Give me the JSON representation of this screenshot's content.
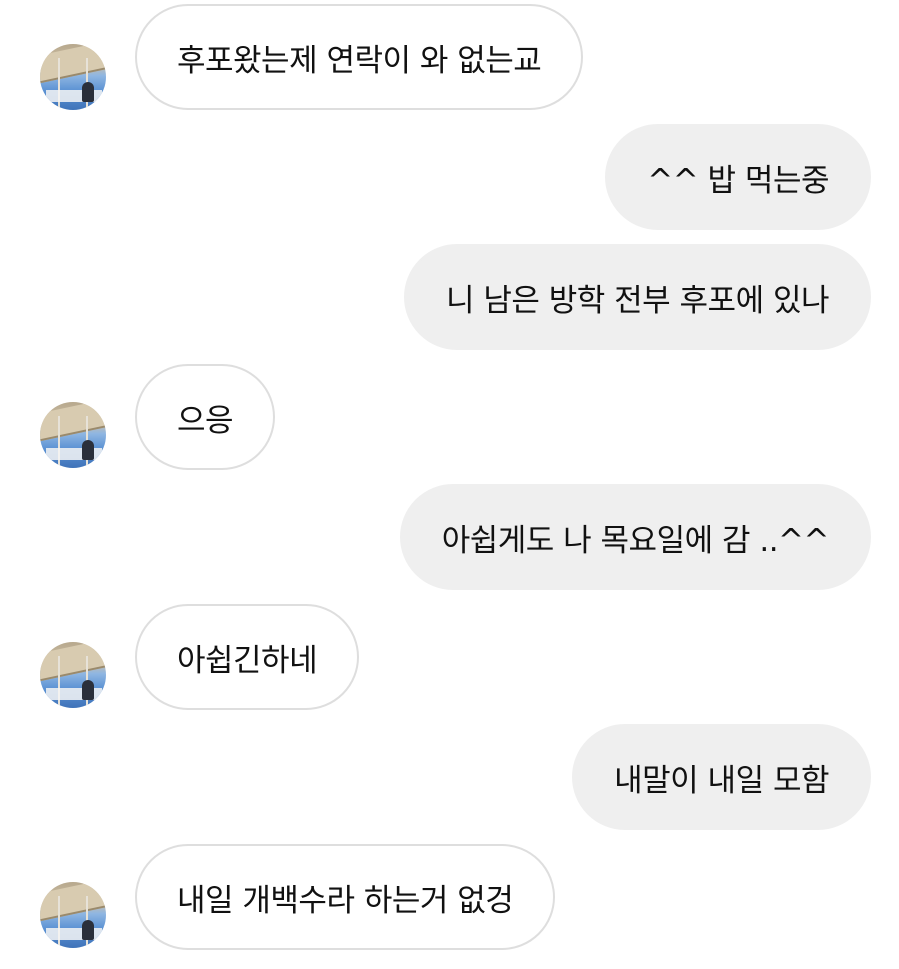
{
  "colors": {
    "incoming_bubble_bg": "#ffffff",
    "incoming_bubble_border": "#dedede",
    "outgoing_bubble_bg": "#efefef",
    "text": "#111111"
  },
  "contact": {
    "avatar_icon": "profile-photo"
  },
  "messages": [
    {
      "direction": "incoming",
      "text": "후포왔는제 연락이 와 없는교"
    },
    {
      "direction": "outgoing",
      "text": "^^ 밥 먹는중"
    },
    {
      "direction": "outgoing",
      "text": "니 남은 방학 전부 후포에 있나"
    },
    {
      "direction": "incoming",
      "text": "으응"
    },
    {
      "direction": "outgoing",
      "text": "아쉽게도 나 목요일에 감 ..^^"
    },
    {
      "direction": "incoming",
      "text": "아쉽긴하네"
    },
    {
      "direction": "outgoing",
      "text": "내말이 내일 모함"
    },
    {
      "direction": "incoming",
      "text": "내일 개백수라 하는거 없겅"
    }
  ]
}
